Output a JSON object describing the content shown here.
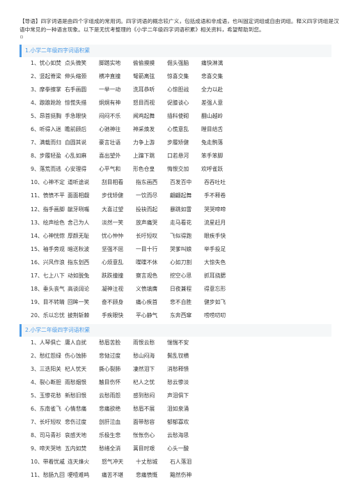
{
  "intro": {
    "text": "【导语】四字词语是由四个字组成的常用词。四字词语的概念较广义，包括成语和非成语，也叫固定词组或自由词组。释义四字词组是汉语中常见的一种语言现象。以下是无忧考整理的《小学二年级四字词语积累》相关资料，希望帮助到您。"
  },
  "colors": {
    "accent": "#4a9be8",
    "header_bg": "#f5f7f8",
    "text": "#333333"
  },
  "sections": [
    {
      "title": "1.小学二年级四字词语积累",
      "rows": [
        [
          "1、忧心如焚",
          "点头微笑",
          "脚踏实地",
          "偷偷摸摸",
          "倔头强脑",
          "痛快淋漓"
        ],
        [
          "2、竖起脊梁",
          "伸头缩颈",
          "横冲直撞",
          "弩箭离弦",
          "惊喜交集",
          "悲喜交集"
        ],
        [
          "3、摩拳擦掌",
          "右手画圆",
          "一举一动",
          "洗耳恭听",
          "心惊胆战",
          "全力以赴"
        ],
        [
          "4、踉踉跄跄",
          "惊慌失措",
          "炯炯有神",
          "怒目而视",
          "促膝谈心",
          "差强人意"
        ],
        [
          "5、昂首挺胸",
          "手急眼快",
          "闷闷不乐",
          "闻鸡起舞",
          "插科使砌",
          "翻山越岭"
        ],
        [
          "6、听得入迷",
          "瞻前顾后",
          "心驰神往",
          "神采焕发",
          "心慌意乱",
          "瞠目结舌"
        ],
        [
          "7、满载而归",
          "自圆其说",
          "豪言壮语",
          "力争上游",
          "步履矫健",
          "兔走鹘落"
        ],
        [
          "8、步履轻盈",
          "心乱如麻",
          "喜出望外",
          "上蹿下跳",
          "口若悬河",
          "笨手笨脚"
        ],
        [
          "9、落荒而逃",
          "心安理得",
          "心平气和",
          "形色仓皇",
          "悔恨交加",
          "欢呼雀跃"
        ],
        [
          "10、心神不定",
          "道听途说",
          "刮目相看",
          "指东画西",
          "百发百中",
          "吞吞吐吐"
        ],
        [
          "11、愤愤不平",
          "面面相觑",
          "步伐矫健",
          "一饮而尽",
          "翩翩起舞",
          "手不释卷"
        ],
        [
          "12、指手画脚",
          "龇牙咧嘴",
          "大喜过望",
          "投袂而起",
          "暴跳如雷",
          "哭哭啼啼"
        ],
        [
          "13、绘声绘色",
          "舍己为人",
          "淡然一笑",
          "放声痛哭",
          "走马看花",
          "流星赶月"
        ],
        [
          "14、心神恍惚",
          "厚颜无耻",
          "忧心忡忡",
          "长吁短叹",
          "飞似得跑",
          "眼疾手快"
        ],
        [
          "15、袖手旁观",
          "暗送秋波",
          "坚强不屈",
          "一目十行",
          "哭爹叫娘",
          "举手投足"
        ],
        [
          "16、兴风作浪",
          "指东划西",
          "心烦意乱",
          "喋喋不休",
          "心如刀割",
          "大惊失色"
        ],
        [
          "17、七上八下",
          "动如脱兔",
          "跌跌撞撞",
          "察言观色",
          "挖空心思",
          "抓耳挠腮"
        ],
        [
          "18、垂头丧气",
          "高谈阔论",
          "凝神注视",
          "义愤填膺",
          "日夜兼程",
          "得意忘形"
        ],
        [
          "19、目不转睛",
          "回眸一笑",
          "奋不顾身",
          "痛心疾首",
          "悲不自胜",
          "健步如飞"
        ],
        [
          "20、乐以忘忧",
          "披荆斩棘",
          "手疾眼快",
          "平心静气",
          "东奔西窜",
          "唠唠叨叨"
        ]
      ]
    },
    {
      "title": "2.小学二年级四字词语积累",
      "rows": [
        [
          "1、人琴俱亡",
          "庸人自扰",
          "愁眉苦脸",
          "雨恨云愁",
          "惴惴不安"
        ],
        [
          "2、愁红怨绿",
          "伤心蚀肺",
          "悲恸过度",
          "愁山闷海",
          "鬓乱钗横"
        ],
        [
          "3、三迭阳关",
          "杞人忧天",
          "撕心裂肺",
          "凄然泪下",
          "消愁释愦"
        ],
        [
          "4、裂心断胆",
          "雨愁烟恨",
          "触目伤怀",
          "杞人之忧",
          "愁云惨淡"
        ],
        [
          "5、玉惨花愁",
          "新愁旧恨",
          "云愁雨怨",
          "感到愁闷",
          "声泪俱下"
        ],
        [
          "6、东南雀飞",
          "心情悲痛",
          "悲痛欲绝",
          "愁眉不展",
          "泪如泉涌"
        ],
        [
          "7、长吁短叹",
          "悲伤过度",
          "剖肝泣血",
          "面带愁容",
          "郁郁寡欢"
        ],
        [
          "8、司马青衫",
          "哀感天地",
          "乐极生悲",
          "怅怅伤心",
          "云愁海思"
        ],
        [
          "9、啼天哭地",
          "五内如焚",
          "愁绪全消",
          "蒿目时艰",
          "心头一酸"
        ],
        [
          "10、带着忧戚",
          "连天烽火",
          "怒气冲天",
          "十丈愁城",
          "石人落泪"
        ],
        [
          "11、愁肠九回",
          "哽噎难鸣",
          "痛苦不堪",
          "悲痛愤慨",
          "黯然伤神"
        ]
      ]
    }
  ]
}
